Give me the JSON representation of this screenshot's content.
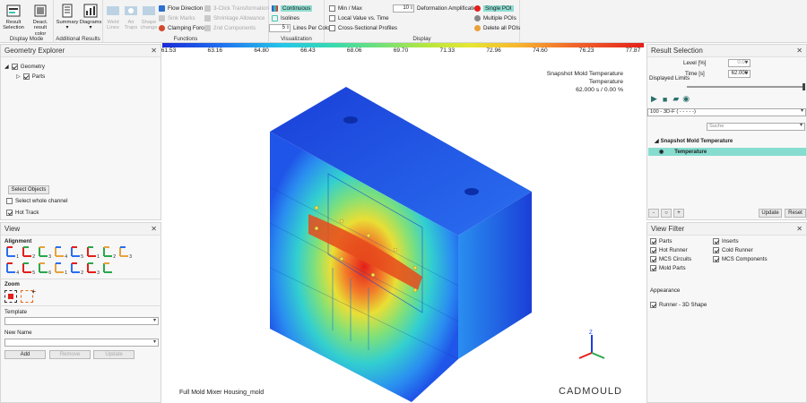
{
  "ribbon": {
    "display_mode": {
      "label": "Display Mode",
      "result_selection": "Result Selection",
      "deact_result_color": "Deact. result color"
    },
    "additional_results": {
      "label": "Additional Results",
      "summary": "Summary",
      "diagrams": "Diagrams"
    },
    "functions": {
      "label": "Functions",
      "weld_lines": "Weld Lines",
      "air_traps": "Air Traps",
      "shape_change": "Shape change",
      "flow_direction": "Flow Direction",
      "sink_marks": "Sink Marks",
      "clamping_force": "Clamping Force",
      "click3": "3-Click Transformation",
      "shrinkage": "Shrinkage Allowance",
      "comp2d": "2nd Components"
    },
    "visualization": {
      "label": "Visualization",
      "continuous": "Continuous",
      "isolines": "Isolines",
      "lines_per_color_value": "5",
      "lines_per_color": "Lines Per Color"
    },
    "display": {
      "label": "Display",
      "min_max": "Min / Max",
      "local_value": "Local Value vs. Time",
      "cross_section": "Cross-Sectional Profiles",
      "deformation_value": "10",
      "deformation_amp": "Deformation Amplification",
      "single_poi": "Single POI",
      "multiple_pois": "Multiple POIs",
      "delete_pois": "Delete all POIs"
    }
  },
  "geometry_explorer": {
    "title": "Geometry Explorer",
    "tree": [
      {
        "label": "Geometry"
      },
      {
        "label": "Parts"
      }
    ],
    "select_objects": "Select Objects",
    "select_whole_channel": "Select whole channel",
    "hot_track": "Hot Track"
  },
  "view": {
    "title": "View",
    "alignment": "Alignment",
    "zoom": "Zoom",
    "template": "Template",
    "template_value": "",
    "new_name": "New Name",
    "new_name_value": "",
    "add": "Add",
    "remove": "Remove",
    "update": "Update",
    "align_digits": [
      "1",
      "2",
      "3",
      "4",
      "5",
      "1",
      "2",
      "3",
      "4",
      "5",
      "6",
      "1",
      "2",
      "3"
    ]
  },
  "viewport": {
    "scale_ticks": [
      "61.53",
      "63.16",
      "64.80",
      "66.43",
      "68.06",
      "69.70",
      "71.33",
      "72.96",
      "74.60",
      "76.23",
      "77.87"
    ],
    "info_line1": "Snapshot Mold Temperature",
    "info_line2": "Temperature",
    "info_line3": "62.000 s  /  0.00 %",
    "model_name": "Full Mold Mixer Housing_mold",
    "brand": "CADMOULD",
    "axes": {
      "x": "X",
      "y": "Y",
      "z": "Z"
    }
  },
  "result_selection": {
    "title": "Result Selection",
    "level_label": "Level [%]",
    "level_value": "0.00",
    "time_label": "Time [s]",
    "time_value": "62.000",
    "displayed_limits": "Displayed Limits",
    "run_select": "100 - 3D-F ( - - - - -)",
    "search_placeholder": "Suche",
    "group": "Snapshot Mold Temperature",
    "item": "Temperature",
    "update": "Update",
    "reset": "Reset",
    "nav": [
      "-",
      "○",
      "+"
    ]
  },
  "view_filter": {
    "title": "View Filter",
    "items": [
      {
        "label": "Parts"
      },
      {
        "label": "Inserts"
      },
      {
        "label": "Hot Runner"
      },
      {
        "label": "Cold Runner"
      },
      {
        "label": "MCS Circuits"
      },
      {
        "label": "MCS Components"
      },
      {
        "label": "Mold Parts"
      }
    ],
    "appearance": "Appearance",
    "runner": "Runner - 3D Shape"
  },
  "colors": {
    "accent": "#3fc8b4",
    "blue": "#1a3fd8",
    "red": "#e31f1a",
    "teal_row": "#86dccf"
  }
}
